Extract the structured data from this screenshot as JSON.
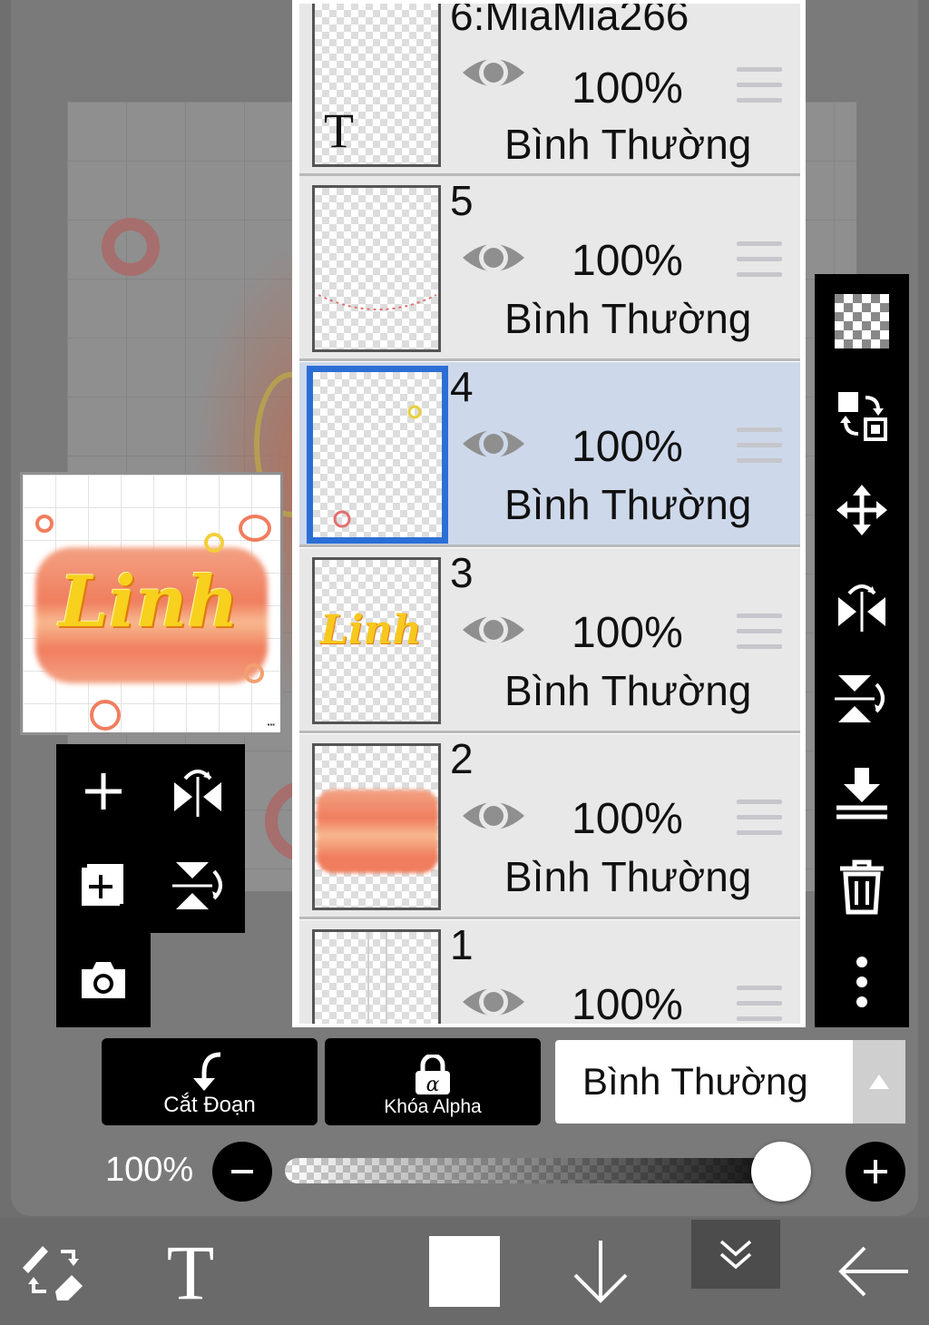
{
  "layers": [
    {
      "name": "6:MiaMia266",
      "opacity": "100%",
      "blend": "Bình Thường",
      "visible": true,
      "selected": false,
      "type": "text",
      "thumb_glyph": "T"
    },
    {
      "name": "5",
      "opacity": "100%",
      "blend": "Bình Thường",
      "visible": true,
      "selected": false
    },
    {
      "name": "4",
      "opacity": "100%",
      "blend": "Bình Thường",
      "visible": true,
      "selected": true
    },
    {
      "name": "3",
      "opacity": "100%",
      "blend": "Bình Thường",
      "visible": true,
      "selected": false,
      "thumb_text": "Linh"
    },
    {
      "name": "2",
      "opacity": "100%",
      "blend": "Bình Thường",
      "visible": true,
      "selected": false
    },
    {
      "name": "1",
      "opacity": "100%",
      "blend": "",
      "visible": true,
      "selected": false
    }
  ],
  "preview": {
    "artwork_text": "Linh"
  },
  "actions": {
    "clipping_label": "Cắt Đoạn",
    "alpha_lock_label": "Khóa Alpha",
    "blend_mode": "Bình Thường"
  },
  "opacity_slider": {
    "label": "100%",
    "value": 1.0
  },
  "colors": {
    "selected_layer_bg": "#cdd8ea",
    "selection_border": "#2b6fd6",
    "panel_bg": "#e8e8e8",
    "toolbar_bg": "#000000",
    "text_color": "#f7d11e",
    "paint_color": "#f07e5e"
  },
  "icons": {
    "left_palette": [
      "add-layer-icon",
      "flip-horizontal-icon",
      "duplicate-layer-icon",
      "flip-vertical-icon",
      "camera-icon"
    ],
    "right_bar": [
      "transparency-checker-icon",
      "layer-transfer-icon",
      "move-icon",
      "flip-horizontal-icon",
      "flip-vertical-icon",
      "merge-down-icon",
      "trash-icon",
      "more-icon"
    ],
    "bottom_bar": [
      "brush-eraser-swap-icon",
      "text-tool-icon",
      "color-swatch-icon",
      "down-arrow-icon",
      "layers-collapse-icon",
      "back-arrow-icon"
    ]
  }
}
